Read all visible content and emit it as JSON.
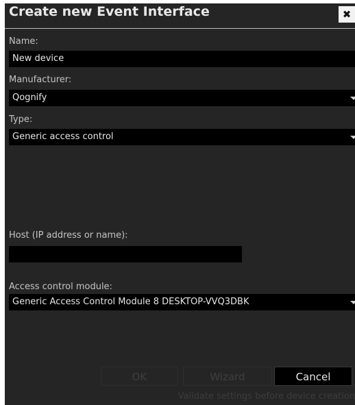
{
  "dialog": {
    "title": "Create new Event Interface",
    "close_glyph": "✖"
  },
  "fields": {
    "name_label": "Name:",
    "name_value": "New device",
    "manufacturer_label": "Manufacturer:",
    "manufacturer_value": "Qognify",
    "type_label": "Type:",
    "type_value": "Generic access control",
    "host_label": "Host (IP address or name):",
    "host_value": "",
    "module_label": "Access control module:",
    "module_value": "Generic Access Control Module 8 DESKTOP-VVQ3DBK"
  },
  "buttons": {
    "ok": "OK",
    "wizard": "Wizard",
    "cancel": "Cancel"
  },
  "status": {
    "hint": "Validate settings before device creation"
  },
  "icons": {
    "close": "close-icon",
    "dropdown": "chevron-down-icon"
  },
  "colors": {
    "background": "#252525",
    "field": "#000000",
    "text": "#c8c8c8"
  }
}
